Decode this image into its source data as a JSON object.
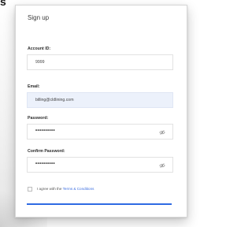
{
  "form": {
    "title": "Sign up",
    "fields": [
      {
        "label": "Account ID:",
        "value": "9999"
      },
      {
        "label": "Email:",
        "value": "billing@cldlining.com"
      },
      {
        "label": "Password:",
        "value": "••••••••••"
      },
      {
        "label": "Confirm Password:",
        "value": "••••••••••"
      }
    ],
    "agree_prefix": "I agree with the ",
    "agree_link": "Terms & Conditions"
  },
  "colors": {
    "accent": "#2f6be3",
    "active_field_bg": "#ecf1fb"
  }
}
